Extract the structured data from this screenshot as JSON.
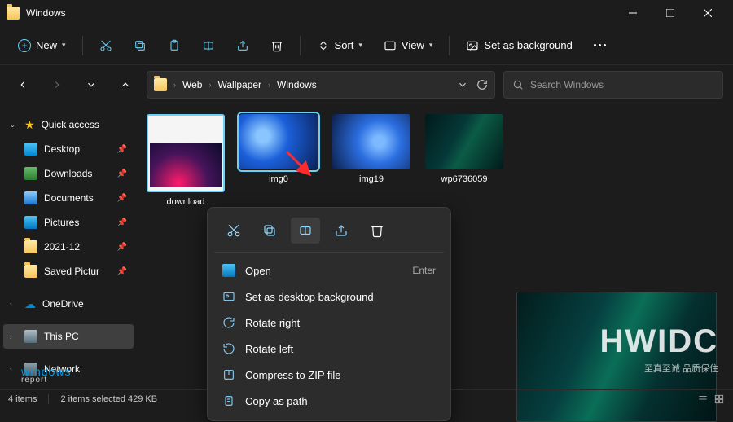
{
  "window_title": "Windows",
  "toolbar": {
    "new": "New",
    "sort": "Sort",
    "view": "View",
    "set_bg": "Set as background"
  },
  "breadcrumb": [
    "Web",
    "Wallpaper",
    "Windows"
  ],
  "search_placeholder": "Search Windows",
  "sidebar": {
    "quick_access": "Quick access",
    "items": [
      {
        "label": "Desktop"
      },
      {
        "label": "Downloads"
      },
      {
        "label": "Documents"
      },
      {
        "label": "Pictures"
      },
      {
        "label": "2021-12"
      },
      {
        "label": "Saved Pictur"
      }
    ],
    "onedrive": "OneDrive",
    "thispc": "This PC",
    "network": "Network"
  },
  "thumbs": [
    {
      "label": "download"
    },
    {
      "label": "img0"
    },
    {
      "label": "img19"
    },
    {
      "label": "wp6736059"
    }
  ],
  "ctx": {
    "open": "Open",
    "open_hint": "Enter",
    "setbg": "Set as desktop background",
    "rright": "Rotate right",
    "rleft": "Rotate left",
    "zip": "Compress to ZIP file",
    "copypath": "Copy as path"
  },
  "status": {
    "count": "4 items",
    "selected": "2 items selected  429 KB"
  },
  "watermark": {
    "line1": "HWIDC",
    "line2": "至真至诚 品质保住"
  }
}
